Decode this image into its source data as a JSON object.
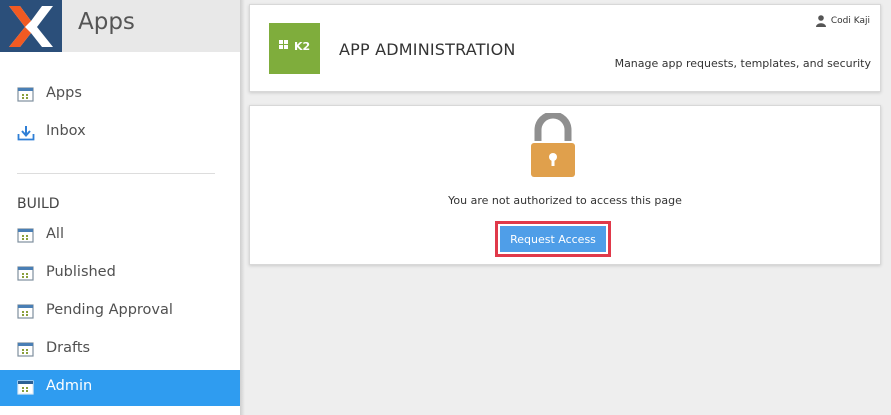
{
  "sidebar": {
    "title": "Apps",
    "top_items": [
      {
        "label": "Apps"
      },
      {
        "label": "Inbox"
      }
    ],
    "section_title": "BUILD",
    "build_items": [
      {
        "label": "All"
      },
      {
        "label": "Published"
      },
      {
        "label": "Pending Approval"
      },
      {
        "label": "Drafts"
      },
      {
        "label": "Admin"
      }
    ],
    "active_item": "Admin"
  },
  "header": {
    "logo_text": "K2",
    "title": "APP ADMINISTRATION",
    "subtitle": "Manage app requests, templates, and security",
    "user_name": "Codi Kaji"
  },
  "main": {
    "message": "You are not authorized to access this page",
    "request_button_label": "Request Access"
  },
  "colors": {
    "logo_bg": "#2b4f7a",
    "logo_x_orange": "#f15a22",
    "active_nav": "#2f9cf0",
    "k2_green": "#7fad3c",
    "lock_body": "#e0a04c",
    "lock_shackle": "#8f8f8f",
    "button_blue": "#4f9ee8",
    "highlight_red": "#e0394a"
  }
}
